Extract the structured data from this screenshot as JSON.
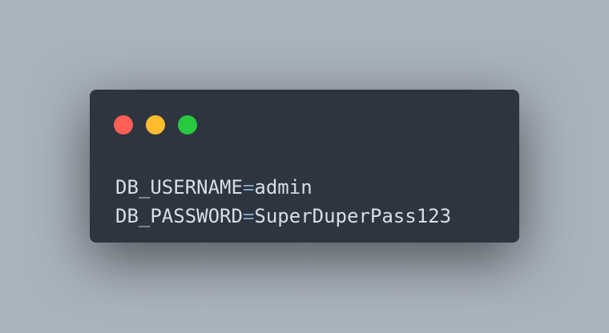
{
  "window": {
    "buttons": [
      {
        "name": "close",
        "color": "#ff5f56"
      },
      {
        "name": "minimize",
        "color": "#ffbd2e"
      },
      {
        "name": "maximize",
        "color": "#27c93f"
      }
    ]
  },
  "code": {
    "lines": [
      {
        "key": "DB_USERNAME",
        "op": "=",
        "value": "admin"
      },
      {
        "key": "DB_PASSWORD",
        "op": "=",
        "value": "SuperDuperPass123"
      }
    ]
  },
  "colors": {
    "background": "#a9b3bd",
    "window": "#2e3440",
    "text": "#d8dee9",
    "operator": "#81a1c1"
  }
}
